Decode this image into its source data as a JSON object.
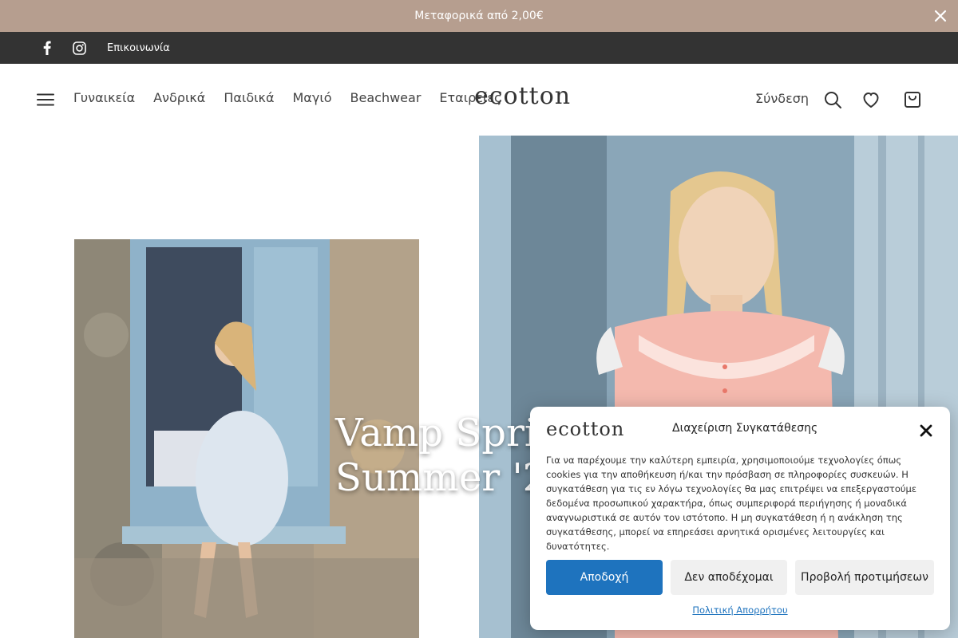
{
  "promo": {
    "text": "Μεταφορικά από 2,00€"
  },
  "topbar": {
    "contact_label": "Επικοινωνία"
  },
  "nav": {
    "items": [
      "Γυναικεία",
      "Ανδρικά",
      "Παιδικά",
      "Μαγιό",
      "Beachwear",
      "Εταιρείες"
    ]
  },
  "header": {
    "logo": "ecotton",
    "login_label": "Σύνδεση"
  },
  "hero": {
    "title": "Vamp Sprin\nSummer '2"
  },
  "cookie": {
    "logo": "ecotton",
    "title": "Διαχείριση Συγκατάθεσης",
    "body": "Για να παρέχουμε την καλύτερη εμπειρία, χρησιμοποιούμε τεχνολογίες όπως cookies για την αποθήκευση ή/και την πρόσβαση σε πληροφορίες συσκευών. Η συγκατάθεση για τις εν λόγω τεχνολογίες θα μας επιτρέψει να επεξεργαστούμε δεδομένα προσωπικού χαρακτήρα, όπως συμπεριφορά περιήγησης ή μοναδικά αναγνωριστικά σε αυτόν τον ιστότοπο. Η μη συγκατάθεση ή η ανάκληση της συγκατάθεσης, μπορεί να επηρεάσει αρνητικά ορισμένες λειτουργίες και δυνατότητες.",
    "accept_label": "Αποδοχή",
    "deny_label": "Δεν αποδέχομαι",
    "prefs_label": "Προβολή προτιμήσεων",
    "policy_label": "Πολιτική Απορρήτου"
  },
  "colors": {
    "promo_bg": "#b69e8f",
    "topbar_bg": "#333333",
    "accent": "#1e73be"
  }
}
